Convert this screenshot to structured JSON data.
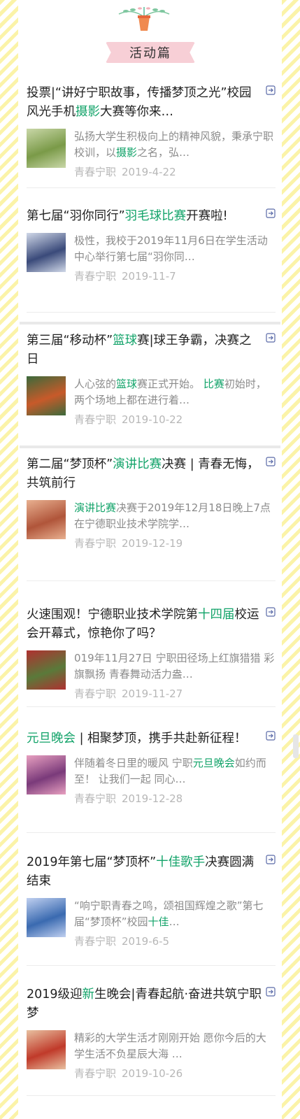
{
  "section": {
    "title": "活动篇"
  },
  "colors": {
    "highlight": "#12a369",
    "ribbon": "#f7cfd6",
    "stripe": "#fbf3a8"
  },
  "icons": {
    "header": "potted-plant-icon",
    "item_link": "share-link-icon"
  },
  "items": [
    {
      "title": [
        "投票|“讲好宁职故事，传播梦顶之光”校园风光手机",
        {
          "hl": "摄影"
        },
        "大赛等你来…"
      ],
      "desc": [
        "弘扬大学生积极向上的精神风貌，秉承宁职校训，以",
        {
          "hl": "摄影"
        },
        "之名，弘…"
      ],
      "source": "青春宁职",
      "date": "2019-4-22"
    },
    {
      "title": [
        "第七届“羽你同行”",
        {
          "hl": "羽毛球比赛"
        },
        "开赛啦!"
      ],
      "desc": [
        "极性，我校于2019年11月6日在学生活动中心举行第七届“羽你同…"
      ],
      "source": "青春宁职",
      "date": "2019-11-7"
    },
    {
      "title": [
        "第三届“移动杯”",
        {
          "hl": "篮球"
        },
        "赛|球王争霸，决赛之日"
      ],
      "desc": [
        "人心弦的",
        {
          "hl": "篮球"
        },
        "赛正式开始。 ",
        {
          "hl": "比赛"
        },
        "初始时，两个场地上都在进行着…"
      ],
      "source": "青春宁职",
      "date": "2019-10-22"
    },
    {
      "title": [
        "第二届“梦顶杯”",
        {
          "hl": "演讲比赛"
        },
        "决赛 | 青春无悔，共筑前行"
      ],
      "desc": [
        {
          "hl": "演讲比赛"
        },
        "决赛于2019年12月18日晚上7点在宁德职业技术学院学…"
      ],
      "source": "青春宁职",
      "date": "2019-12-19"
    },
    {
      "title": [
        "火速围观！宁德职业技术学院第",
        {
          "hl": "十四届"
        },
        "校运会开幕式，惊艳你了吗？"
      ],
      "desc": [
        "019年11月27日 宁职田径场上红旗猎猎 彩旗飘扬 青春舞动活力盎…"
      ],
      "source": "青春宁职",
      "date": "2019-11-27"
    },
    {
      "title": [
        {
          "hl": "元旦晚会"
        },
        " | 相聚梦顶，携手共赴新征程！"
      ],
      "desc": [
        "伴随着冬日里的暖风 宁职",
        {
          "hl": "元旦晚会"
        },
        "如约而至！ 让我们一起 同心…"
      ],
      "source": "青春宁职",
      "date": "2019-12-28"
    },
    {
      "title": [
        "2019年第七届“梦顶杯”",
        {
          "hl": "十佳歌手"
        },
        "决赛圆满结束"
      ],
      "desc": [
        "“响宁职青春之鸣，颂祖国辉煌之歌”第七届“梦顶杯”校园",
        {
          "hl": "十佳"
        },
        "…"
      ],
      "source": "青春宁职",
      "date": "2019-6-5"
    },
    {
      "title": [
        "2019级迎",
        {
          "hl": "新"
        },
        "生晚会|青春起航·奋进共筑宁职梦"
      ],
      "desc": [
        "精彩的大学生活才刚刚开始 愿你今后的大学生活不负星辰大海 …"
      ],
      "source": "青春宁职",
      "date": "2019-10-26"
    }
  ]
}
